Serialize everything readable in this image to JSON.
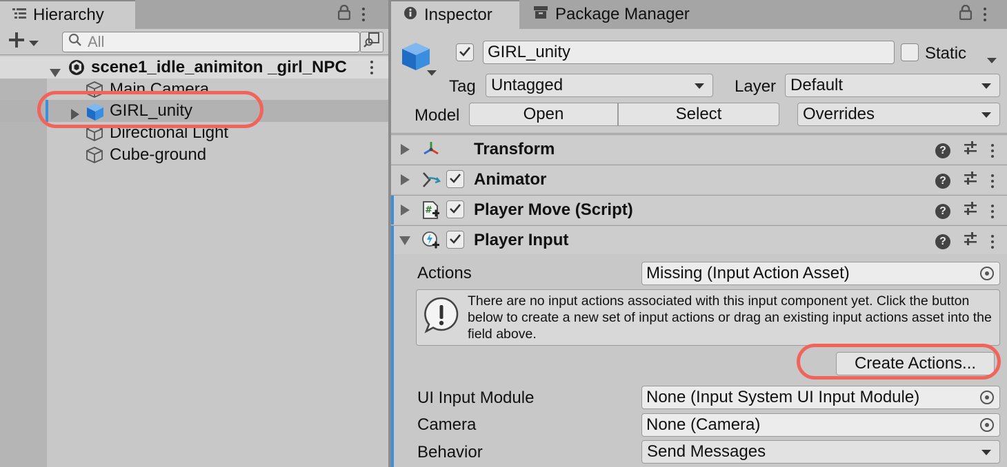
{
  "hierarchy": {
    "tab_label": "Hierarchy",
    "search_placeholder": "All",
    "scene_name": "scene1_idle_animiton _girl_NPC",
    "items": [
      {
        "label": "Main Camera"
      },
      {
        "label": "GIRL_unity"
      },
      {
        "label": "Directional Light"
      },
      {
        "label": "Cube-ground"
      }
    ]
  },
  "inspector": {
    "tab_label": "Inspector",
    "tab2_label": "Package Manager",
    "object_name": "GIRL_unity",
    "static_label": "Static",
    "tag_label": "Tag",
    "tag_value": "Untagged",
    "layer_label": "Layer",
    "layer_value": "Default",
    "model_label": "Model",
    "open_label": "Open",
    "select_label": "Select",
    "overrides_label": "Overrides",
    "components": [
      {
        "name": "Transform"
      },
      {
        "name": "Animator"
      },
      {
        "name": "Player Move (Script)"
      },
      {
        "name": "Player Input"
      }
    ],
    "player_input": {
      "actions_label": "Actions",
      "actions_value": "Missing (Input Action Asset)",
      "help_text": "There are no input actions associated with this input component yet. Click the button below to create a new set of input actions or drag an existing input actions asset into the field above.",
      "create_actions_label": "Create Actions...",
      "ui_module_label": "UI Input Module",
      "ui_module_value": "None (Input System UI Input Module)",
      "camera_label": "Camera",
      "camera_value": "None (Camera)",
      "behavior_label": "Behavior",
      "behavior_value": "Send Messages"
    }
  },
  "colors": {
    "highlight_ring": "#f0645a",
    "selection_accent": "#3d8fd8",
    "panel_bg": "#c8c8c8"
  }
}
